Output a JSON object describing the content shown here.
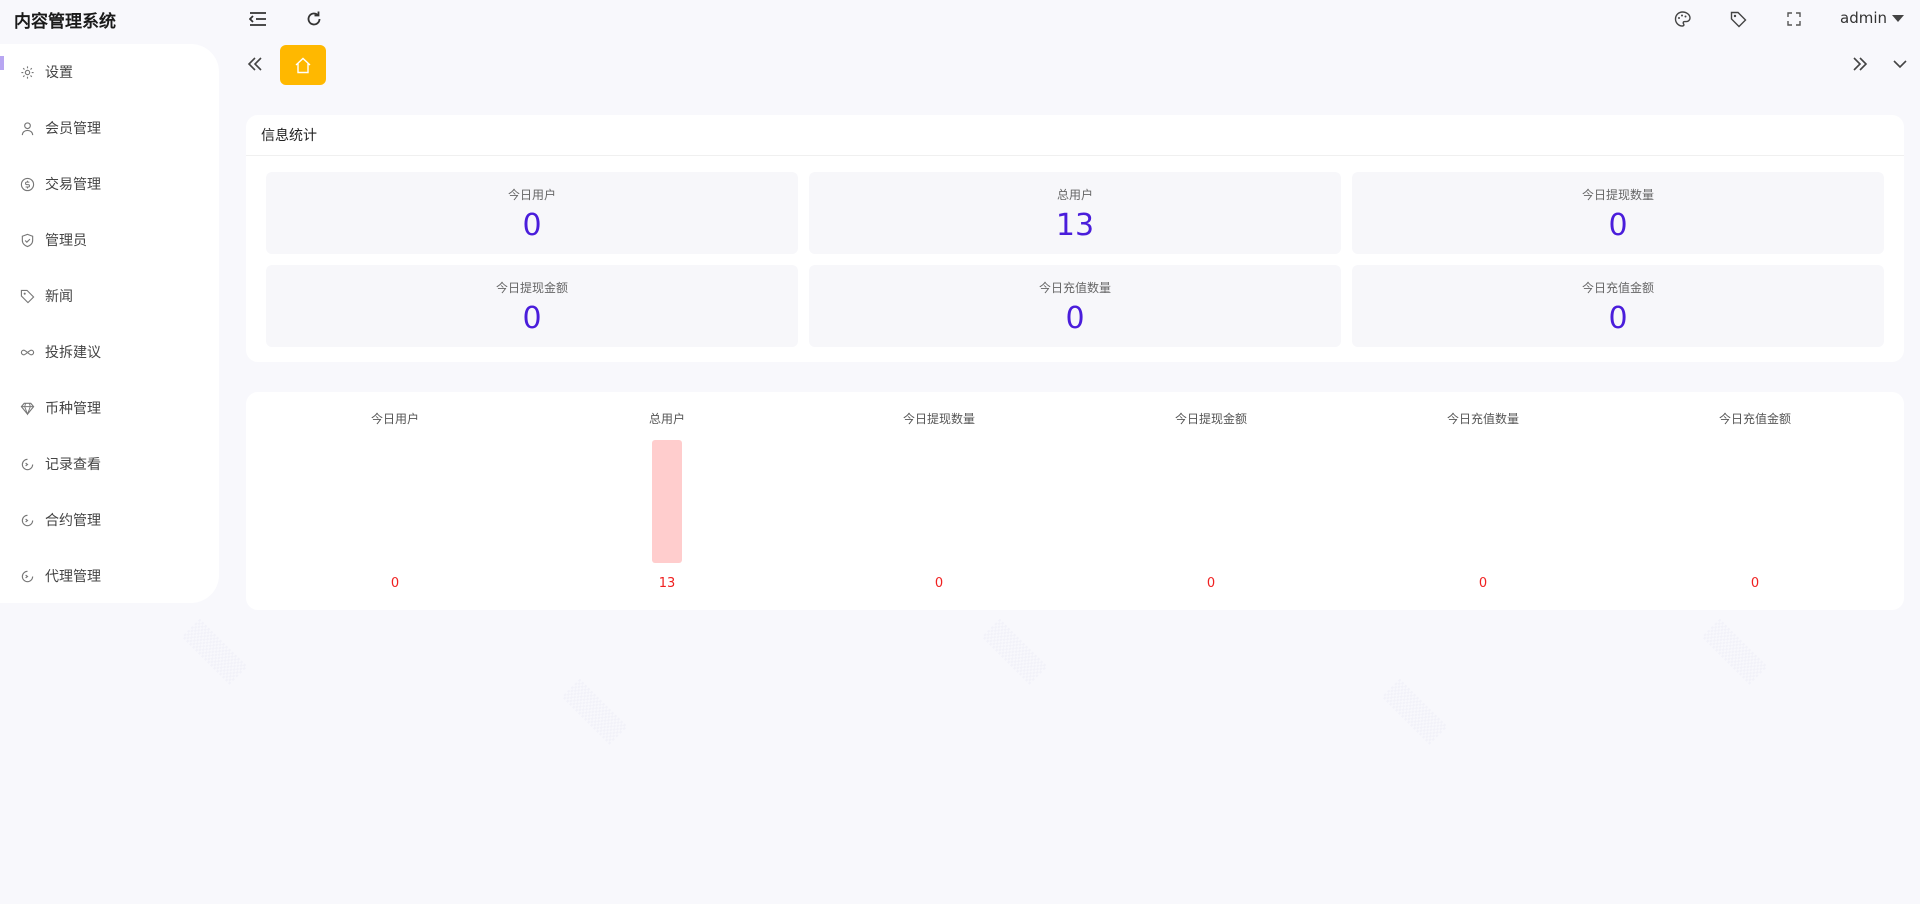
{
  "app": {
    "title": "内容管理系统"
  },
  "header": {
    "user": "admin"
  },
  "sidebar": {
    "items": [
      {
        "label": "设置",
        "icon": "gear-icon"
      },
      {
        "label": "会员管理",
        "icon": "user-icon"
      },
      {
        "label": "交易管理",
        "icon": "dollar-icon"
      },
      {
        "label": "管理员",
        "icon": "shield-check-icon"
      },
      {
        "label": "新闻",
        "icon": "tag-icon"
      },
      {
        "label": "投拆建议",
        "icon": "infinity-icon"
      },
      {
        "label": "币种管理",
        "icon": "diamond-icon"
      },
      {
        "label": "记录查看",
        "icon": "cycle-icon"
      },
      {
        "label": "合约管理",
        "icon": "cycle-icon"
      },
      {
        "label": "代理管理",
        "icon": "cycle-icon"
      }
    ]
  },
  "info_card": {
    "title": "信息统计",
    "stats": [
      {
        "label": "今日用户",
        "value": "0"
      },
      {
        "label": "总用户",
        "value": "13"
      },
      {
        "label": "今日提现数量",
        "value": "0"
      },
      {
        "label": "今日提现金额",
        "value": "0"
      },
      {
        "label": "今日充值数量",
        "value": "0"
      },
      {
        "label": "今日充值金额",
        "value": "0"
      }
    ]
  },
  "colors": {
    "accent": "#ffb800",
    "value": "#4a1ddb",
    "bar": "#ffcdcd",
    "bar_label": "#f02020"
  },
  "chart_data": {
    "type": "bar",
    "categories": [
      "今日用户",
      "总用户",
      "今日提现数量",
      "今日提现金额",
      "今日充值数量",
      "今日充值金额"
    ],
    "values": [
      0,
      13,
      0,
      0,
      0,
      0
    ],
    "ylim": [
      0,
      13
    ],
    "grid": false
  }
}
